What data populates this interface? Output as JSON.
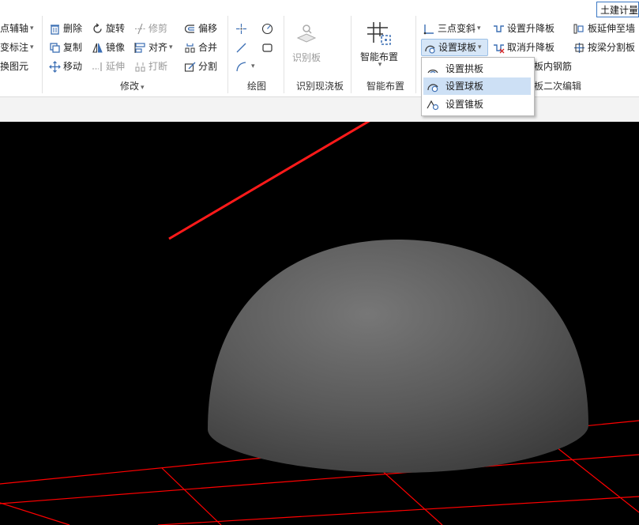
{
  "top_button": "土建计量",
  "ribbon": {
    "group0": {
      "items": [
        "点辅轴",
        "变标注",
        "换图元"
      ]
    },
    "modify": {
      "label": "修改",
      "col1": [
        "删除",
        "复制",
        "移动"
      ],
      "col2": [
        "旋转",
        "镜像",
        "延伸"
      ],
      "col3": [
        "修剪",
        "对齐",
        "打断"
      ],
      "col4": [
        "偏移",
        "合并",
        "分割"
      ]
    },
    "draw": {
      "label": "绘图"
    },
    "identify": {
      "button": "识别板",
      "label": "识别现浇板"
    },
    "smart": {
      "button": "智能布置",
      "label": "智能布置"
    },
    "slab": {
      "col1": [
        "三点变斜",
        "设置球板"
      ],
      "col2": [
        "设置升降板",
        "取消升降板",
        "板内钢筋"
      ],
      "col3": [
        "板延伸至墙",
        "按梁分割板"
      ],
      "label_suffix": "板二次编辑"
    }
  },
  "dropdown": {
    "items": [
      "设置拱板",
      "设置球板",
      "设置锥板"
    ],
    "selected_index": 1
  },
  "colors": {
    "arrow": "#ff1a1a",
    "grid": "#ff0000",
    "accent": "#3b78c4",
    "viewport": "#000000"
  }
}
